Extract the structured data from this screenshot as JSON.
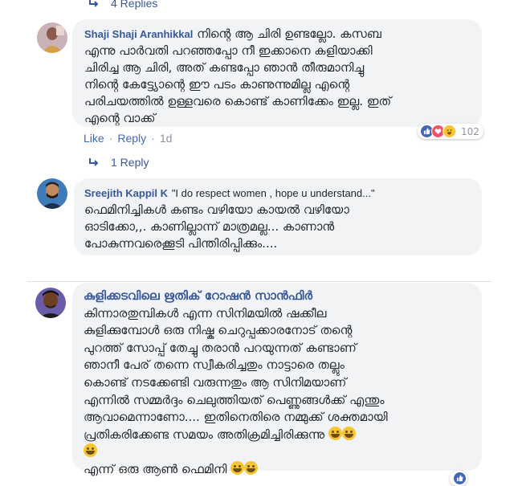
{
  "replies_top": {
    "label": "4 Replies"
  },
  "comment1": {
    "author": "Shaji Shaji Aranhikkal",
    "lines": [
      "നിന്റെ ആ ചിരി ഉണ്ടല്ലോ. കസബ",
      "എന്നു പാർവതി പറഞ്ഞപ്പോ നീ ഇക്കാനെ കളിയാക്കി",
      "ചിരിച്ച ആ ചിരി, അത് കണ്ടപ്പോ ഞാൻ തീരുമാനിച്ചു",
      "നിന്റെ കേട്ട്യോന്റെ ഈ പടം കാണുന്നുമില്ല എന്റെ",
      "പരിചയത്തിൽ ഉള്ളവരെ കൊണ്ട് കാണിക്കേം ഇല്ല. ഇത്",
      "എന്റെ വാക്ക്"
    ],
    "like": "Like",
    "sep": "·",
    "reply": "Reply",
    "time": "1d",
    "reaction_count": "102"
  },
  "replies_mid": {
    "label": "1 Reply"
  },
  "comment2": {
    "author": "Sreejith Kappil K",
    "quote": "\"I do respect women , hope u understand...\"",
    "lines": [
      "ഫെമിനിച്ചികൾ കണ്ടം വഴിയോ കായൽ വഴിയോ",
      "ഓടിക്കോ,,. കാണില്ലാന്ന് മാത്രമല്ല... കാണാൻ",
      "പോകുന്നവരെക്കൂടി പിന്തിരിപ്പിക്കും...."
    ]
  },
  "comment3": {
    "author": "കുളിക്കടവിലെ ഋതിക് റോഷൻ സാൻഫിർ",
    "lines": [
      "കിന്നാരതുമ്പികൾ എന്ന സിനിമയിൽ ഷക്കീല",
      "കുളിക്കുമ്പോൾ ഒരു നിഷ്കു ചെറുപ്പക്കാരനോട് തന്റെ",
      "പുറത്ത് സോപ്പ് തേച്ചു തരാൻ പറയുന്നത് കണ്ടാണ്",
      "ഞാനീ പേര് തന്നെ സ്വീകരിച്ചതും നാട്ടാരെ തല്ലും",
      "കൊണ്ട് നടക്കേണ്ടി വരുന്നതും ആ സിനിമയാണ്",
      "എന്നിൽ സമ്മർദ്ദം ചെലുത്തിയത് പെണ്ണുങ്ങൾക്ക് എന്തും",
      "ആവാമെന്നാണോ.... ഇതിനെതിരെ നമ്മുക്ക് ശക്തമായി",
      "പ്രതികരിക്കേണ്ട സമയം അതിക്രമിച്ചിരിക്കുന്നു"
    ],
    "last_line": "എന്ന് ഒരു ആൺ ഫെമിനി"
  },
  "icons": {
    "reply_arrow": "reply-arrow-icon",
    "like": "like-reaction-icon",
    "love": "love-reaction-icon",
    "haha": "haha-reaction-icon",
    "emoji": "laughing-emoji-icon"
  },
  "colors": {
    "link_blue": "#365899",
    "bubble_bg": "#f2f3f5",
    "meta_grey": "#90949c",
    "like_blue": "#4267b2",
    "love_red": "#f25268",
    "haha_yellow": "#f7c531"
  }
}
